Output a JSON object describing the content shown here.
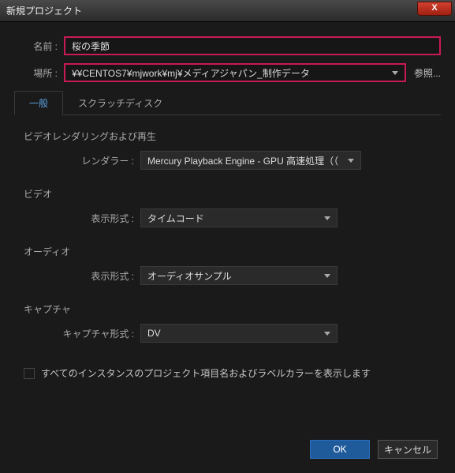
{
  "window": {
    "title": "新規プロジェクト",
    "close_glyph": "X"
  },
  "fields": {
    "name_label": "名前 :",
    "name_value": "桜の季節",
    "location_label": "場所 :",
    "location_value": "¥¥CENTOS7¥mjwork¥mj¥メディアジャパン_制作データ",
    "browse_label": "参照..."
  },
  "tabs": {
    "general": "一般",
    "scratch": "スクラッチディスク"
  },
  "groups": {
    "rendering": {
      "title": "ビデオレンダリングおよび再生",
      "renderer_label": "レンダラー :",
      "renderer_value": "Mercury Playback Engine - GPU 高速処理（（"
    },
    "video": {
      "title": "ビデオ",
      "format_label": "表示形式 :",
      "format_value": "タイムコード"
    },
    "audio": {
      "title": "オーディオ",
      "format_label": "表示形式 :",
      "format_value": "オーディオサンプル"
    },
    "capture": {
      "title": "キャプチャ",
      "format_label": "キャプチャ形式 :",
      "format_value": "DV"
    }
  },
  "checkbox": {
    "label": "すべてのインスタンスのプロジェクト項目名およびラベルカラーを表示します"
  },
  "buttons": {
    "ok": "OK",
    "cancel": "キャンセル"
  }
}
